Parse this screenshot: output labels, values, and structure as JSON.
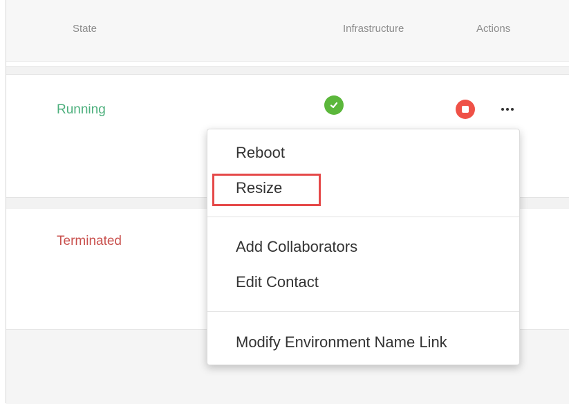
{
  "table": {
    "headers": {
      "state": "State",
      "infrastructure": "Infrastructure",
      "actions": "Actions"
    },
    "rows": [
      {
        "state": "Running",
        "state_color": "#4caf7c",
        "infrastructure_status": "ok",
        "has_stop": true
      },
      {
        "state": "Terminated",
        "state_color": "#c9504d"
      }
    ]
  },
  "menu": {
    "items": [
      {
        "label": "Reboot"
      },
      {
        "label": "Resize",
        "highlighted": true
      },
      {
        "label": "Add Collaborators"
      },
      {
        "label": "Edit Contact"
      },
      {
        "label": "Modify Environment Name Link"
      }
    ],
    "highlight_color": "#e54848"
  },
  "icons": {
    "infra_ok": "check-circle-icon",
    "stop": "stop-circle-icon",
    "more": "more-horizontal-icon"
  },
  "colors": {
    "ok_green": "#5bb73b",
    "stop_red": "#ef5147"
  }
}
